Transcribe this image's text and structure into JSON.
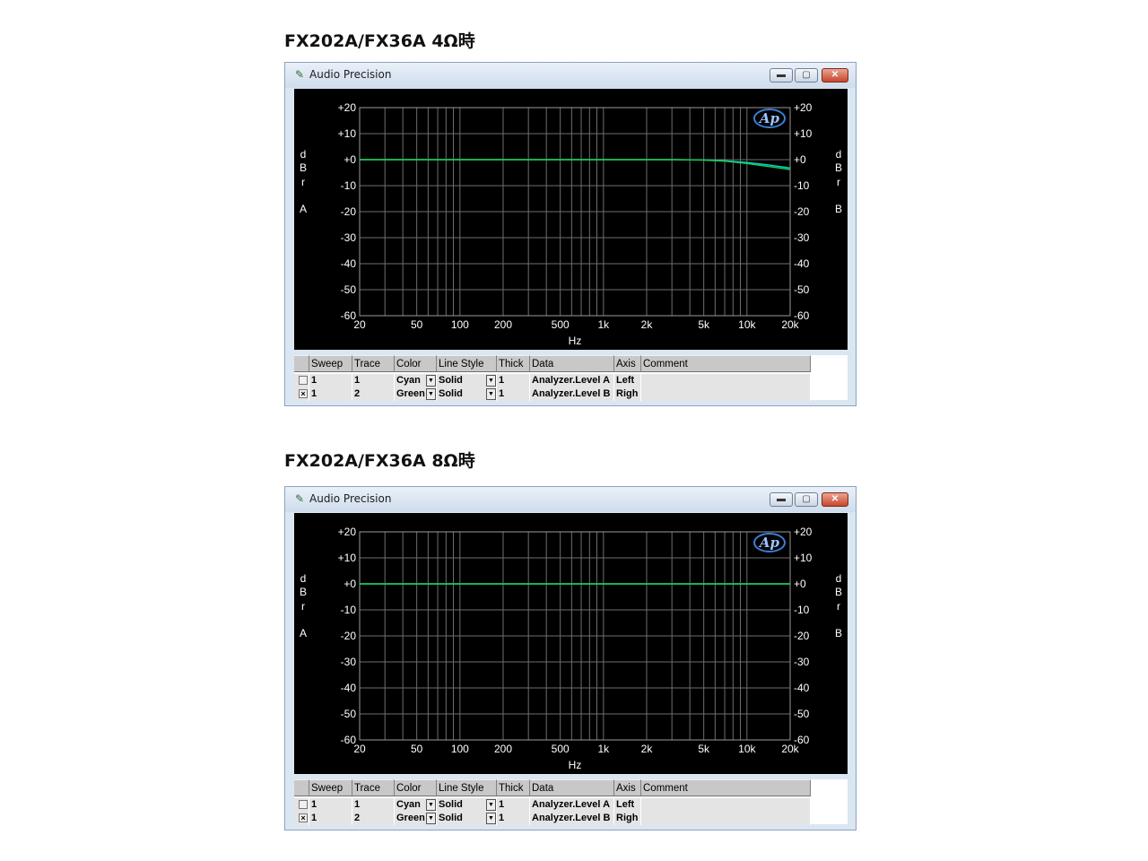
{
  "panels": [
    {
      "heading": "FX202A/FX36A 4Ω時",
      "window": {
        "title": "Audio Precision",
        "min_icon": "minimize-icon",
        "max_icon": "maximize-icon",
        "close_icon": "close-icon"
      },
      "chart_data": {
        "type": "line",
        "xlabel": "Hz",
        "ylabel_left": [
          "d",
          "B",
          "r",
          "A"
        ],
        "ylabel_right": [
          "d",
          "B",
          "r",
          "B"
        ],
        "x_scale": "log",
        "xlim": [
          20,
          20000
        ],
        "ylim": [
          -60,
          20
        ],
        "x_ticks": [
          {
            "v": 20,
            "t": "20"
          },
          {
            "v": 50,
            "t": "50"
          },
          {
            "v": 100,
            "t": "100"
          },
          {
            "v": 200,
            "t": "200"
          },
          {
            "v": 500,
            "t": "500"
          },
          {
            "v": 1000,
            "t": "1k"
          },
          {
            "v": 2000,
            "t": "2k"
          },
          {
            "v": 5000,
            "t": "5k"
          },
          {
            "v": 10000,
            "t": "10k"
          },
          {
            "v": 20000,
            "t": "20k"
          }
        ],
        "y_ticks": [
          {
            "v": 20,
            "t": "+20"
          },
          {
            "v": 10,
            "t": "+10"
          },
          {
            "v": 0,
            "t": "+0"
          },
          {
            "v": -10,
            "t": "-10"
          },
          {
            "v": -20,
            "t": "-20"
          },
          {
            "v": -30,
            "t": "-30"
          },
          {
            "v": -40,
            "t": "-40"
          },
          {
            "v": -50,
            "t": "-50"
          },
          {
            "v": -60,
            "t": "-60"
          }
        ],
        "grid": true,
        "logo": "Ap",
        "series": [
          {
            "color": "#00d8d8",
            "x": [
              20,
              1000,
              3000,
              5000,
              7000,
              10000,
              14000,
              20000
            ],
            "y": [
              0,
              0,
              0,
              -0.1,
              -0.4,
              -1.1,
              -2.0,
              -3.2
            ]
          },
          {
            "color": "#1fc94a",
            "x": [
              20,
              1000,
              3000,
              5000,
              7000,
              10000,
              14000,
              20000
            ],
            "y": [
              0,
              0,
              0,
              -0.2,
              -0.6,
              -1.5,
              -2.6,
              -3.8
            ]
          }
        ]
      },
      "table": {
        "headers": [
          "Sweep",
          "Trace",
          "Color",
          "Line Style",
          "Thick",
          "Data",
          "Axis",
          "Comment"
        ],
        "rows": [
          {
            "checked": "",
            "sweep": "1",
            "trace": "1",
            "color": "Cyan",
            "style": "Solid",
            "thick": "1",
            "data": "Analyzer.Level A",
            "axis": "Left",
            "comment": ""
          },
          {
            "checked": "×",
            "sweep": "1",
            "trace": "2",
            "color": "Green",
            "style": "Solid",
            "thick": "1",
            "data": "Analyzer.Level B",
            "axis": "Righ",
            "comment": ""
          }
        ]
      }
    },
    {
      "heading": "FX202A/FX36A 8Ω時",
      "window": {
        "title": "Audio Precision",
        "min_icon": "minimize-icon",
        "max_icon": "maximize-icon",
        "close_icon": "close-icon"
      },
      "chart_data": {
        "type": "line",
        "xlabel": "Hz",
        "ylabel_left": [
          "d",
          "B",
          "r",
          "A"
        ],
        "ylabel_right": [
          "d",
          "B",
          "r",
          "B"
        ],
        "x_scale": "log",
        "xlim": [
          20,
          20000
        ],
        "ylim": [
          -60,
          20
        ],
        "x_ticks": [
          {
            "v": 20,
            "t": "20"
          },
          {
            "v": 50,
            "t": "50"
          },
          {
            "v": 100,
            "t": "100"
          },
          {
            "v": 200,
            "t": "200"
          },
          {
            "v": 500,
            "t": "500"
          },
          {
            "v": 1000,
            "t": "1k"
          },
          {
            "v": 2000,
            "t": "2k"
          },
          {
            "v": 5000,
            "t": "5k"
          },
          {
            "v": 10000,
            "t": "10k"
          },
          {
            "v": 20000,
            "t": "20k"
          }
        ],
        "y_ticks": [
          {
            "v": 20,
            "t": "+20"
          },
          {
            "v": 10,
            "t": "+10"
          },
          {
            "v": 0,
            "t": "+0"
          },
          {
            "v": -10,
            "t": "-10"
          },
          {
            "v": -20,
            "t": "-20"
          },
          {
            "v": -30,
            "t": "-30"
          },
          {
            "v": -40,
            "t": "-40"
          },
          {
            "v": -50,
            "t": "-50"
          },
          {
            "v": -60,
            "t": "-60"
          }
        ],
        "grid": true,
        "logo": "Ap",
        "series": [
          {
            "color": "#00d8d8",
            "x": [
              20,
              1000,
              10000,
              20000
            ],
            "y": [
              0,
              0,
              0,
              0
            ]
          },
          {
            "color": "#1fc94a",
            "x": [
              20,
              1000,
              10000,
              20000
            ],
            "y": [
              0,
              0,
              0,
              0
            ]
          }
        ]
      },
      "table": {
        "headers": [
          "Sweep",
          "Trace",
          "Color",
          "Line Style",
          "Thick",
          "Data",
          "Axis",
          "Comment"
        ],
        "rows": [
          {
            "checked": "",
            "sweep": "1",
            "trace": "1",
            "color": "Cyan",
            "style": "Solid",
            "thick": "1",
            "data": "Analyzer.Level A",
            "axis": "Left",
            "comment": ""
          },
          {
            "checked": "×",
            "sweep": "1",
            "trace": "2",
            "color": "Green",
            "style": "Solid",
            "thick": "1",
            "data": "Analyzer.Level B",
            "axis": "Righ",
            "comment": ""
          }
        ]
      }
    }
  ]
}
